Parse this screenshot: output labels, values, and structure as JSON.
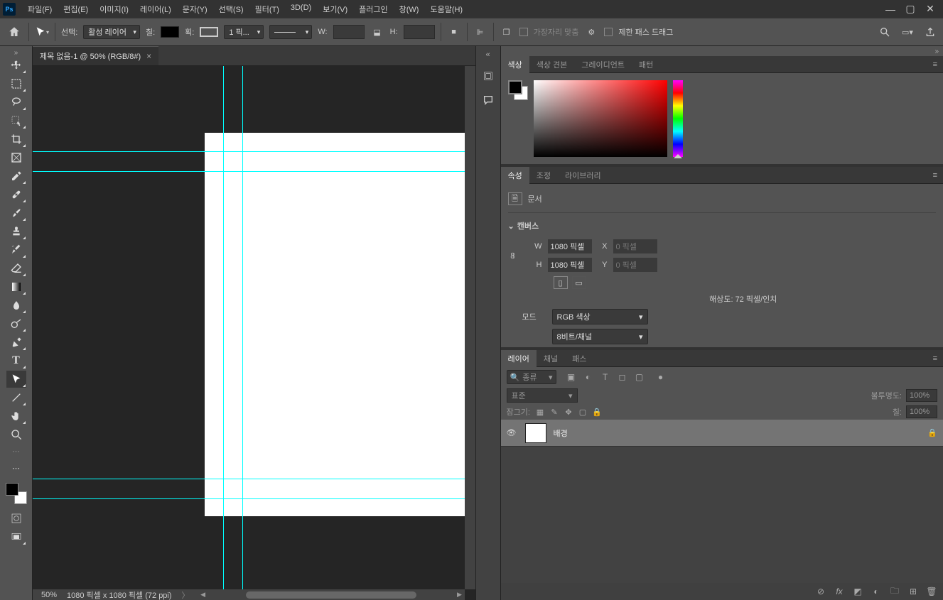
{
  "app": {
    "name": "Ps"
  },
  "menu": {
    "file": "파일(F)",
    "edit": "편집(E)",
    "image": "이미지(I)",
    "layer": "레이어(L)",
    "type": "문자(Y)",
    "select": "선택(S)",
    "filter": "필터(T)",
    "threeD": "3D(D)",
    "view": "보기(V)",
    "plugin": "플러그인",
    "window": "창(W)",
    "help": "도움말(H)"
  },
  "options": {
    "selectionLabel": "선택:",
    "selectionValue": "활성 레이어",
    "fillLabel": "칠:",
    "strokeLabel": "획:",
    "strokeWidth": "1 픽...",
    "wLabel": "W:",
    "hLabel": "H:",
    "edgesLabel": "가장자리 맞춤",
    "restrictLabel": "제한 패스 드래그"
  },
  "document": {
    "tabTitle": "제목 없음-1 @ 50% (RGB/8#)",
    "zoom": "50%",
    "dimensions": "1080 픽셀 x 1080 픽셀 (72 ppi)"
  },
  "panels": {
    "color": {
      "tab": "색상",
      "swatch": "색상 견본",
      "gradient": "그레이디언트",
      "pattern": "패턴"
    },
    "props": {
      "tab": "속성",
      "adjust": "조정",
      "library": "라이브러리",
      "docLabel": "문서",
      "sectionCanvas": "캔버스",
      "w": "W",
      "wVal": "1080 픽셀",
      "h": "H",
      "hVal": "1080 픽셀",
      "x": "X",
      "xVal": "0 픽셀",
      "y": "Y",
      "yVal": "0 픽셀",
      "resolution": "해상도: 72 픽셀/인치",
      "modeLabel": "모드",
      "modeValue": "RGB 색상",
      "depthValue": "8비트/채널"
    },
    "layers": {
      "tab": "레이어",
      "channels": "채널",
      "paths": "패스",
      "filterPlaceholder": "종류",
      "blendMode": "표준",
      "opacityLabel": "불투명도:",
      "opacity": "100%",
      "lockLabel": "잠그기:",
      "fillLabel": "칠:",
      "fillValue": "100%",
      "bgLayer": "배경"
    }
  }
}
